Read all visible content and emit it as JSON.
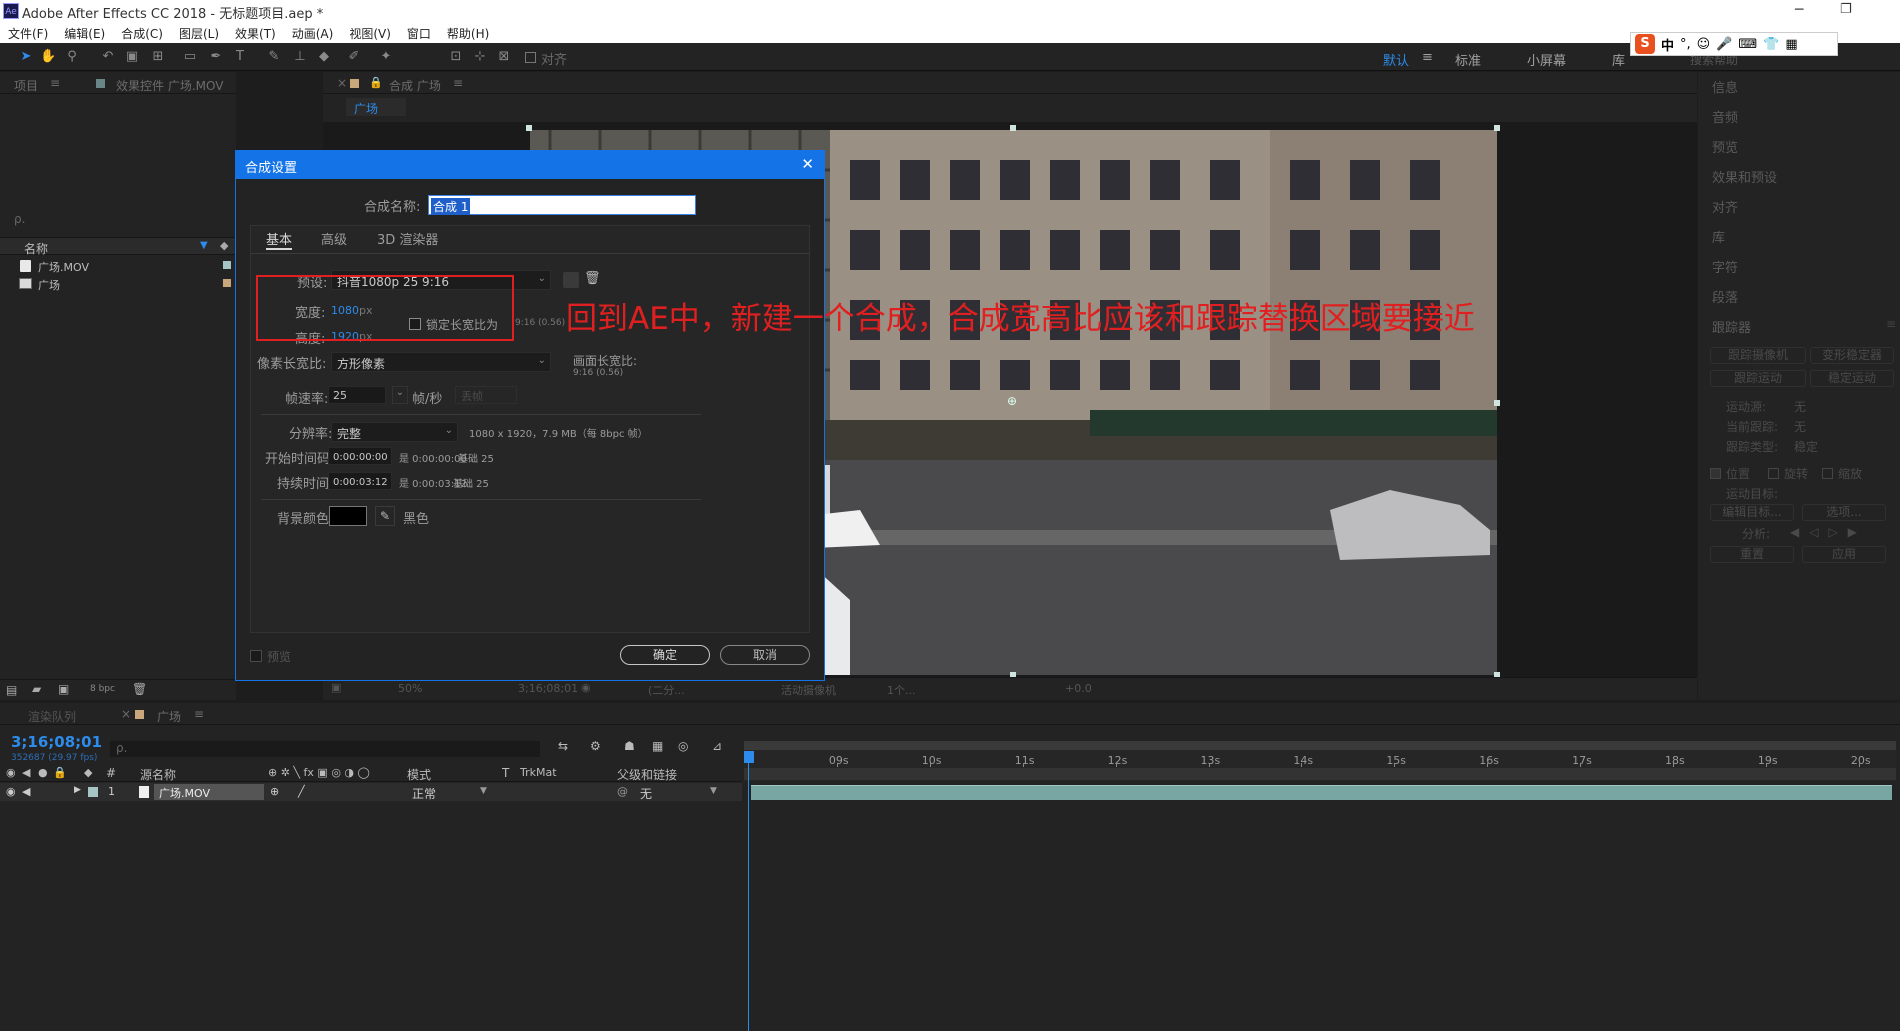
{
  "window": {
    "title": "Adobe After Effects CC 2018 - 无标题项目.aep *",
    "app_icon": "Ae"
  },
  "menu": [
    "文件(F)",
    "编辑(E)",
    "合成(C)",
    "图层(L)",
    "效果(T)",
    "动画(A)",
    "视图(V)",
    "窗口",
    "帮助(H)"
  ],
  "toolbar": {
    "snap_label": "对齐",
    "workspaces": [
      "默认",
      "标准",
      "小屏幕",
      "库"
    ],
    "search_placeholder": "搜索帮助"
  },
  "ime": {
    "items": [
      "中",
      "°,",
      "☺",
      "🎤",
      "⌨",
      "👕",
      "▦"
    ]
  },
  "project_panel": {
    "tabs": [
      "项目",
      "效果控件 广场.MOV"
    ],
    "search_placeholder": "ρ.",
    "col_name": "名称",
    "items": [
      {
        "name": "广场.MOV",
        "label_color": "#a6c4c4"
      },
      {
        "name": "广场",
        "label_color": "#c9a77a"
      }
    ],
    "bpc": "8 bpc"
  },
  "comp_panel": {
    "tab": "合成 广场",
    "breadcrumb": "广场",
    "zoom": "50%",
    "timecode": "3;16;08;01",
    "resolution": "(二分...",
    "camera": "活动摄像机",
    "views": "1个...",
    "offset": "+0.0"
  },
  "right_panel": {
    "items": [
      "信息",
      "音频",
      "预览",
      "效果和预设",
      "对齐",
      "库",
      "字符",
      "段落"
    ],
    "tracker": {
      "title": "跟踪器",
      "buttons": [
        "跟踪摄像机",
        "变形稳定器",
        "跟踪运动",
        "稳定运动"
      ],
      "motion_source": "运动源:",
      "motion_source_value": "无",
      "current_track": "当前跟踪:",
      "current_track_value": "无",
      "track_type": "跟踪类型:",
      "track_type_value": "稳定",
      "position": "位置",
      "rotation": "旋转",
      "scale": "缩放",
      "motion_target": "运动目标:",
      "edit_target": "编辑目标...",
      "options": "选项...",
      "analyze": "分析:",
      "reset": "重置",
      "apply": "应用"
    }
  },
  "dialog": {
    "title": "合成设置",
    "comp_name_label": "合成名称:",
    "comp_name_value": "合成 1",
    "tabs": [
      "基本",
      "高级",
      "3D 渲染器"
    ],
    "preset_label": "预设:",
    "preset_value": "抖音1080p 25 9:16",
    "width_label": "宽度:",
    "width_value": "1080",
    "height_label": "高度:",
    "height_value": "1920",
    "px": "px",
    "lock_label": "锁定长宽比为",
    "lock_ratio": "9:16 (0.56)",
    "pixel_aspect_label": "像素长宽比:",
    "pixel_aspect_value": "方形像素",
    "frame_aspect_label": "画面长宽比:",
    "frame_aspect_value": "9:16 (0.56)",
    "fps_label": "帧速率:",
    "fps_value": "25",
    "fps_unit": "帧/秒",
    "drop_frame": "丢帧",
    "resolution_label": "分辨率:",
    "resolution_value": "完整",
    "resolution_info": "1080 x 1920，7.9 MB（每 8bpc 帧）",
    "start_tc_label": "开始时间码:",
    "start_tc_value": "0:00:00:00",
    "start_tc_info": "是 0:00:00:00",
    "start_tc_base": "基础 25",
    "duration_label": "持续时间:",
    "duration_value": "0:00:03:12",
    "duration_info": "是 0:00:03:12",
    "duration_base": "基础 25",
    "bg_color_label": "背景颜色:",
    "bg_color_name": "黑色",
    "bg_color": "#000000",
    "preview_label": "预览",
    "ok": "确定",
    "cancel": "取消"
  },
  "annotation": {
    "text": "回到AE中，新建一个合成，合成宽高比应该和跟踪替换区域要接近",
    "color": "#e02020"
  },
  "timeline": {
    "tabs": [
      "渲染队列",
      "广场"
    ],
    "timecode": "3;16;08;01",
    "timecode_sub": "352687 (29.97 fps)",
    "search_placeholder": "ρ.",
    "cols": {
      "source": "源名称",
      "mode": "模式",
      "t": "T",
      "trkmat": "TrkMat",
      "parent": "父级和链接"
    },
    "layer": {
      "num": "1",
      "name": "广场.MOV",
      "mode": "正常",
      "parent": "无"
    },
    "ruler": [
      {
        "label": "09s",
        "t": 9
      },
      {
        "label": "10s",
        "t": 10
      },
      {
        "label": "11s",
        "t": 11
      },
      {
        "label": "12s",
        "t": 12
      },
      {
        "label": "13s",
        "t": 13
      },
      {
        "label": "14s",
        "t": 14
      },
      {
        "label": "15s",
        "t": 15
      },
      {
        "label": "16s",
        "t": 16
      },
      {
        "label": "17s",
        "t": 17
      },
      {
        "label": "18s",
        "t": 18
      },
      {
        "label": "19s",
        "t": 19
      },
      {
        "label": "20s",
        "t": 20
      }
    ]
  }
}
